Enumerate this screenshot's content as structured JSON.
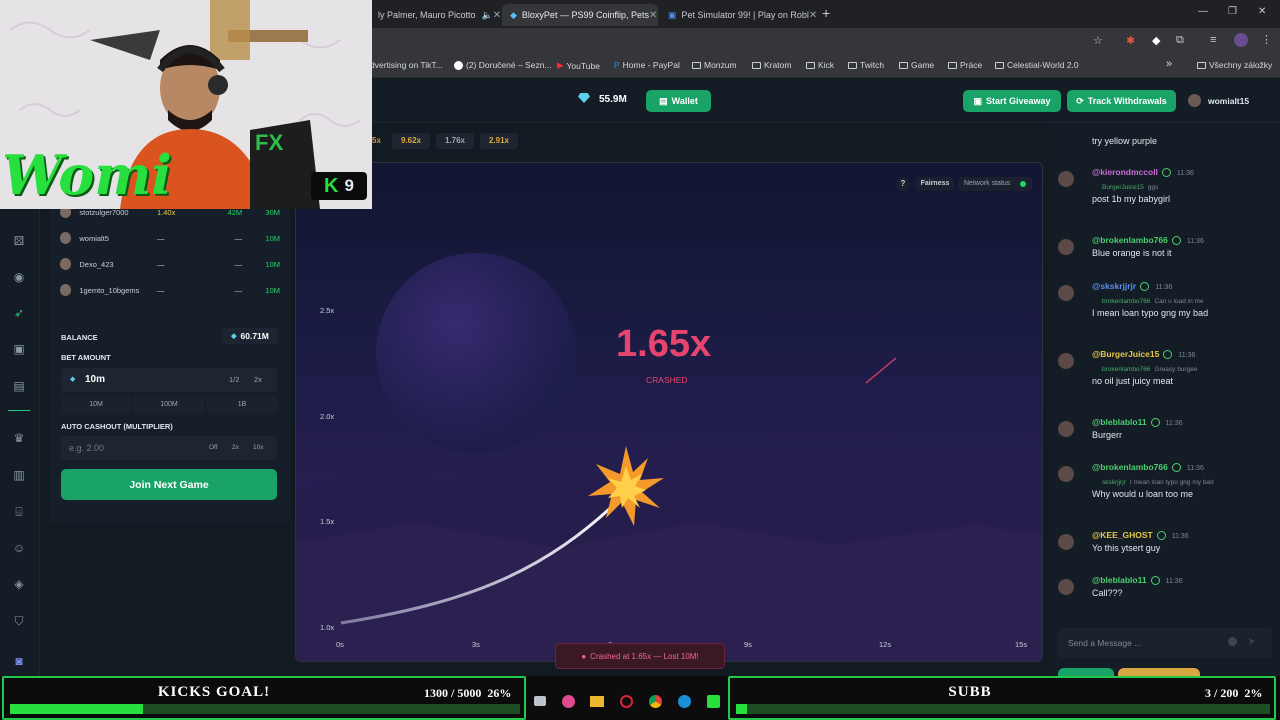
{
  "browser": {
    "tabs": [
      {
        "label": "ly Palmer, Mauro Picotto",
        "active": false
      },
      {
        "label": "BloxyPet — PS99 Coinflip, Pets",
        "active": true
      },
      {
        "label": "Pet Simulator 99! | Play on Robl",
        "active": false
      }
    ],
    "bookmarks": [
      "dvertising on TikT...",
      "(2) Doručené – Sezn...",
      "YouTube",
      "Home - PayPal",
      "Monzum",
      "Kratom",
      "Kick",
      "Twitch",
      "Game",
      "Práce",
      "Celestial-World 2.0"
    ],
    "bookmarks_more": "»",
    "all_bookmarks": "Všechny záložky"
  },
  "header": {
    "balance": "55.9M",
    "wallet_label": "Wallet",
    "giveaway_label": "Start Giveaway",
    "withdrawals_label": "Track Withdrawals",
    "username": "womialt15"
  },
  "history": [
    "5x",
    "9.62x",
    "1.76x",
    "2.91x"
  ],
  "players": [
    {
      "name": "stotzulger7000",
      "mult": "1.40x",
      "win": "42M",
      "bet": "30M"
    },
    {
      "name": "womialt5",
      "mult": "—",
      "win": "—",
      "bet": "10M"
    },
    {
      "name": "Dexo_423",
      "mult": "—",
      "win": "—",
      "bet": "10M"
    },
    {
      "name": "1gemto_10bgems",
      "mult": "—",
      "win": "—",
      "bet": "10M"
    }
  ],
  "panel": {
    "balance_label": "BALANCE",
    "balance_value": "60.71M",
    "bet_label": "BET AMOUNT",
    "bet_value": "10m",
    "half": "1/2",
    "double": "2x",
    "quick": [
      "10M",
      "100M",
      "1B"
    ],
    "cashout_label": "AUTO CASHOUT (MULTIPLIER)",
    "cashout_placeholder": "e.g. 2.00",
    "cashout_opts": [
      "Off",
      "2x",
      "10x"
    ],
    "join_label": "Join Next Game"
  },
  "game": {
    "help": "?",
    "fairness": "Fairness",
    "network": "Network status",
    "multiplier": "1.65x",
    "status": "CRASHED",
    "y_ticks": [
      "2.5x",
      "2.0x",
      "1.5x",
      "1.0x"
    ],
    "x_ticks": [
      "0s",
      "3s",
      "6s",
      "9s",
      "12s",
      "15s"
    ],
    "toast": "Crashed at 1.65x — Lost 10M!"
  },
  "chat": {
    "top_text": "try yellow purple",
    "messages": [
      {
        "user": "@kierondmccoll",
        "time": "11:36",
        "reply": "BurgerJuice15",
        "reply_text": "ggs",
        "text": "post 1b my babygirl",
        "color": "#c86ad8"
      },
      {
        "user": "@brokenlambo766",
        "time": "11:36",
        "reply": "",
        "reply_text": "",
        "text": "Blue orange is not it",
        "color": "#4ccf6e"
      },
      {
        "user": "@skskrjjrjr",
        "time": "11:36",
        "reply": "brokenlambo766",
        "reply_text": "Can u load in me",
        "text": "I mean loan typo gng my bad",
        "color": "#5a8ff0"
      },
      {
        "user": "@BurgerJuice15",
        "time": "11:36",
        "reply": "brokenlambo766",
        "reply_text": "Greasy burgee",
        "text": "no oil just juicy meat",
        "color": "#e6c84a"
      },
      {
        "user": "@bleblablo11",
        "time": "11:36",
        "reply": "",
        "reply_text": "",
        "text": "Burgerr",
        "color": "#4ccf6e"
      },
      {
        "user": "@brokenlambo766",
        "time": "11:36",
        "reply": "skskrjjrjr",
        "reply_text": "I mean loan typo gng my bad",
        "text": "Why would u loan too me",
        "color": "#4ccf6e"
      },
      {
        "user": "@KEE_GHOST",
        "time": "11:36",
        "reply": "",
        "reply_text": "",
        "text": "Yo this ytsert guy",
        "color": "#e6c84a"
      },
      {
        "user": "@bleblablo11",
        "time": "11:36",
        "reply": "",
        "reply_text": "",
        "text": "Call???",
        "color": "#4ccf6e"
      }
    ],
    "input_placeholder": "Send a Message ..."
  },
  "overlay": {
    "streamer_name": "Womi",
    "kick_badge": "9",
    "goal1_title": "KICKS GOAL!",
    "goal1_count": "1300 / 5000",
    "goal1_pct": "26%",
    "goal1_fraction": 0.26,
    "goal2_title": "SUBB",
    "goal2_count": "3 / 200",
    "goal2_pct": "2%",
    "goal2_fraction": 0.02
  },
  "colors": {
    "accent": "#1aa366",
    "crash": "#e8456e",
    "goal_green": "#27e03e"
  }
}
